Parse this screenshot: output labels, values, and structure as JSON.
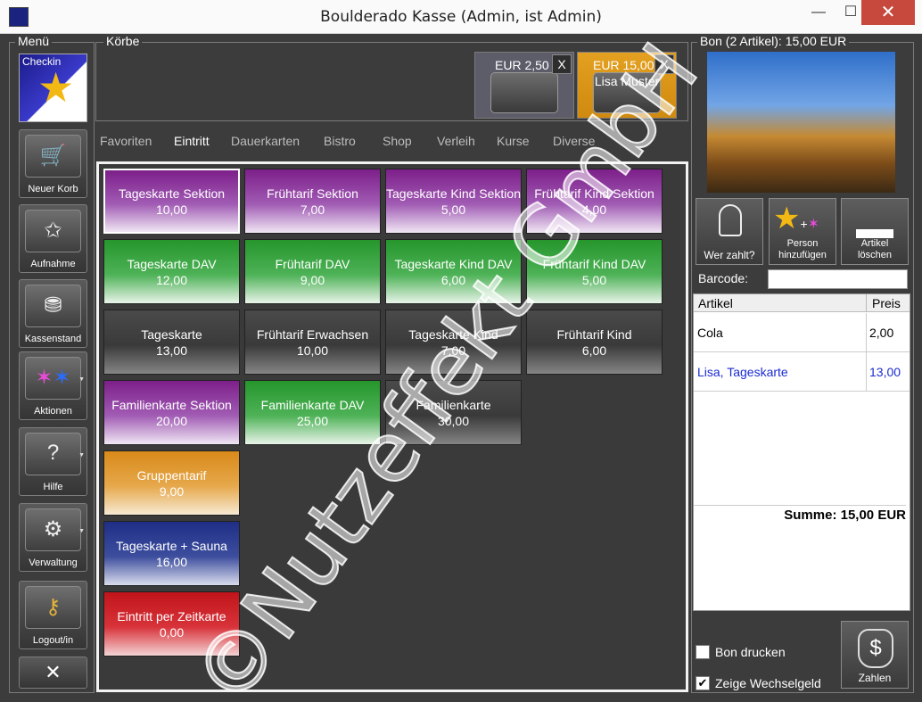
{
  "window": {
    "title": "Boulderado Kasse (Admin, ist Admin)",
    "min": "—",
    "max": "☐",
    "close": "✕"
  },
  "menu": {
    "label": "Menü",
    "checkin": "Checkin",
    "items": [
      {
        "label": "Neuer Korb"
      },
      {
        "label": "Aufnahme"
      },
      {
        "label": "Kassenstand"
      },
      {
        "label": "Aktionen"
      },
      {
        "label": "Hilfe"
      },
      {
        "label": "Verwaltung"
      },
      {
        "label": "Logout/in"
      }
    ]
  },
  "carts": {
    "label": "Körbe",
    "items": [
      {
        "amount": "EUR 2,50",
        "close": "X",
        "name": ""
      },
      {
        "amount": "EUR 15,00",
        "close": "X",
        "name": "Lisa Muster"
      }
    ]
  },
  "tabs": [
    "Favoriten",
    "Eintritt",
    "Dauerkarten",
    "Bistro",
    "Shop",
    "Verleih",
    "Kurse",
    "Diverse"
  ],
  "active_tab": "Eintritt",
  "products": [
    {
      "name": "Tageskarte Sektion",
      "price": "10,00",
      "color": "purple"
    },
    {
      "name": "Frühtarif Sektion",
      "price": "7,00",
      "color": "purple"
    },
    {
      "name": "Tageskarte Kind Sektion",
      "price": "5,00",
      "color": "purple"
    },
    {
      "name": "Frühtarif Kind Sektion",
      "price": "4,00",
      "color": "purple"
    },
    {
      "name": "Tageskarte DAV",
      "price": "12,00",
      "color": "green"
    },
    {
      "name": "Frühtarif DAV",
      "price": "9,00",
      "color": "green"
    },
    {
      "name": "Tageskarte Kind DAV",
      "price": "6,00",
      "color": "green"
    },
    {
      "name": "Frühtarif Kind DAV",
      "price": "5,00",
      "color": "green"
    },
    {
      "name": "Tageskarte",
      "price": "13,00",
      "color": "gray"
    },
    {
      "name": "Frühtarif Erwachsen",
      "price": "10,00",
      "color": "gray"
    },
    {
      "name": "Tageskarte Kind",
      "price": "7,00",
      "color": "gray"
    },
    {
      "name": "Frühtarif Kind",
      "price": "6,00",
      "color": "gray"
    },
    {
      "name": "Familienkarte Sektion",
      "price": "20,00",
      "color": "purple"
    },
    {
      "name": "Familienkarte DAV",
      "price": "25,00",
      "color": "green"
    },
    {
      "name": "Familienkarte",
      "price": "30,00",
      "color": "gray"
    },
    {
      "name": "Gruppentarif",
      "price": "9,00",
      "color": "orange"
    },
    {
      "name": "Tageskarte + Sauna",
      "price": "16,00",
      "color": "blue"
    },
    {
      "name": "Eintritt per Zeitkarte",
      "price": "0,00",
      "color": "red"
    }
  ],
  "bon": {
    "header": "Bon (2 Artikel): 15,00 EUR",
    "actions": {
      "wer_zahlt": "Wer zahlt?",
      "person_add_1": "Person",
      "person_add_2": "hinzufügen",
      "delete_1": "Artikel",
      "delete_2": "löschen"
    },
    "barcode_label": "Barcode:",
    "barcode_value": "",
    "col_article": "Artikel",
    "col_price": "Preis",
    "rows": [
      {
        "article": "Cola",
        "price": "2,00",
        "color": "#000000"
      },
      {
        "article": "Lisa, Tageskarte",
        "price": "13,00",
        "color": "#1a2bd1"
      }
    ],
    "sum": "Summe: 15,00 EUR",
    "print_label": "Bon drucken",
    "print_checked": false,
    "change_label": "Zeige Wechselgeld",
    "change_checked": true,
    "pay_label": "Zahlen",
    "pay_icon": "$"
  },
  "watermark": "©Nutzeffekt GmbH"
}
